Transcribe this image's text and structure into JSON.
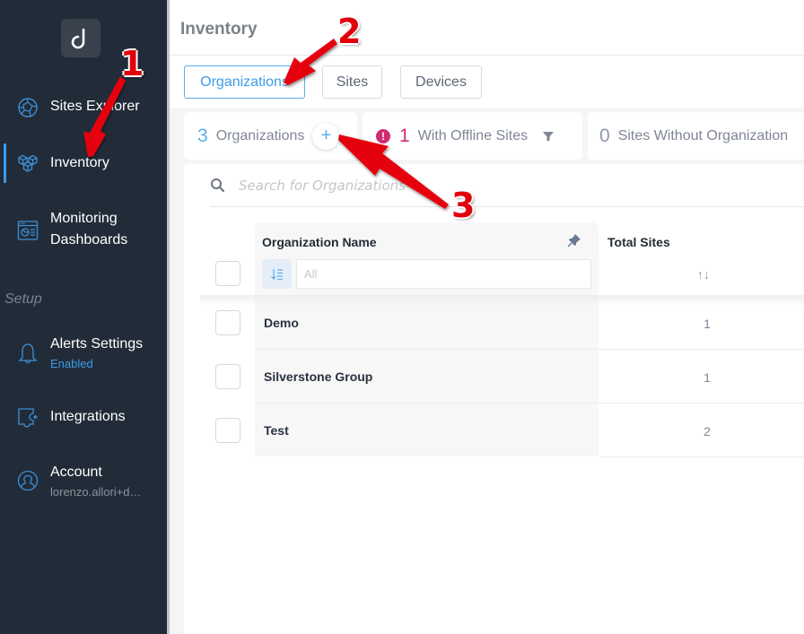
{
  "sidebar": {
    "logo_letter": "d",
    "items": [
      {
        "label": "Sites Explorer",
        "icon": "globe-network-icon"
      },
      {
        "label": "Inventory",
        "icon": "cubes-icon",
        "active": true
      },
      {
        "label": "Monitoring Dashboards",
        "line1": "Monitoring",
        "line2": "Dashboards",
        "icon": "dashboard-icon"
      },
      {
        "label": "Alerts Settings",
        "sub": "Enabled",
        "icon": "bell-icon"
      },
      {
        "label": "Integrations",
        "icon": "puzzle-plug-icon"
      },
      {
        "label": "Account",
        "sub": "lorenzo.allori+d…",
        "icon": "user-circle-icon"
      }
    ],
    "section_setup": "Setup"
  },
  "header": {
    "title": "Inventory"
  },
  "tabs": [
    {
      "label": "Organizations",
      "active": true
    },
    {
      "label": "Sites",
      "active": false
    },
    {
      "label": "Devices",
      "active": false
    }
  ],
  "stats": {
    "organizations": {
      "count": "3",
      "label": "Organizations",
      "add_symbol": "+"
    },
    "offline": {
      "count": "1",
      "label": "With Offline Sites",
      "alert_symbol": "!"
    },
    "without_org": {
      "count": "0",
      "label": "Sites Without Organization"
    }
  },
  "search": {
    "placeholder": "Search for Organizations",
    "value": ""
  },
  "table": {
    "columns": [
      {
        "title": "Organization Name",
        "filter_placeholder": "All"
      },
      {
        "title": "Total Sites",
        "sort_symbol": "↑↓"
      }
    ],
    "rows": [
      {
        "name": "Demo",
        "total_sites": "1"
      },
      {
        "name": "Silverstone Group",
        "total_sites": "1"
      },
      {
        "name": "Test",
        "total_sites": "2"
      }
    ]
  },
  "annotations": [
    "1",
    "2",
    "3"
  ],
  "colors": {
    "sidebar_bg": "#222c39",
    "accent": "#3d9be9",
    "alert": "#cf2b74",
    "annotation_red": "#e1000a"
  }
}
